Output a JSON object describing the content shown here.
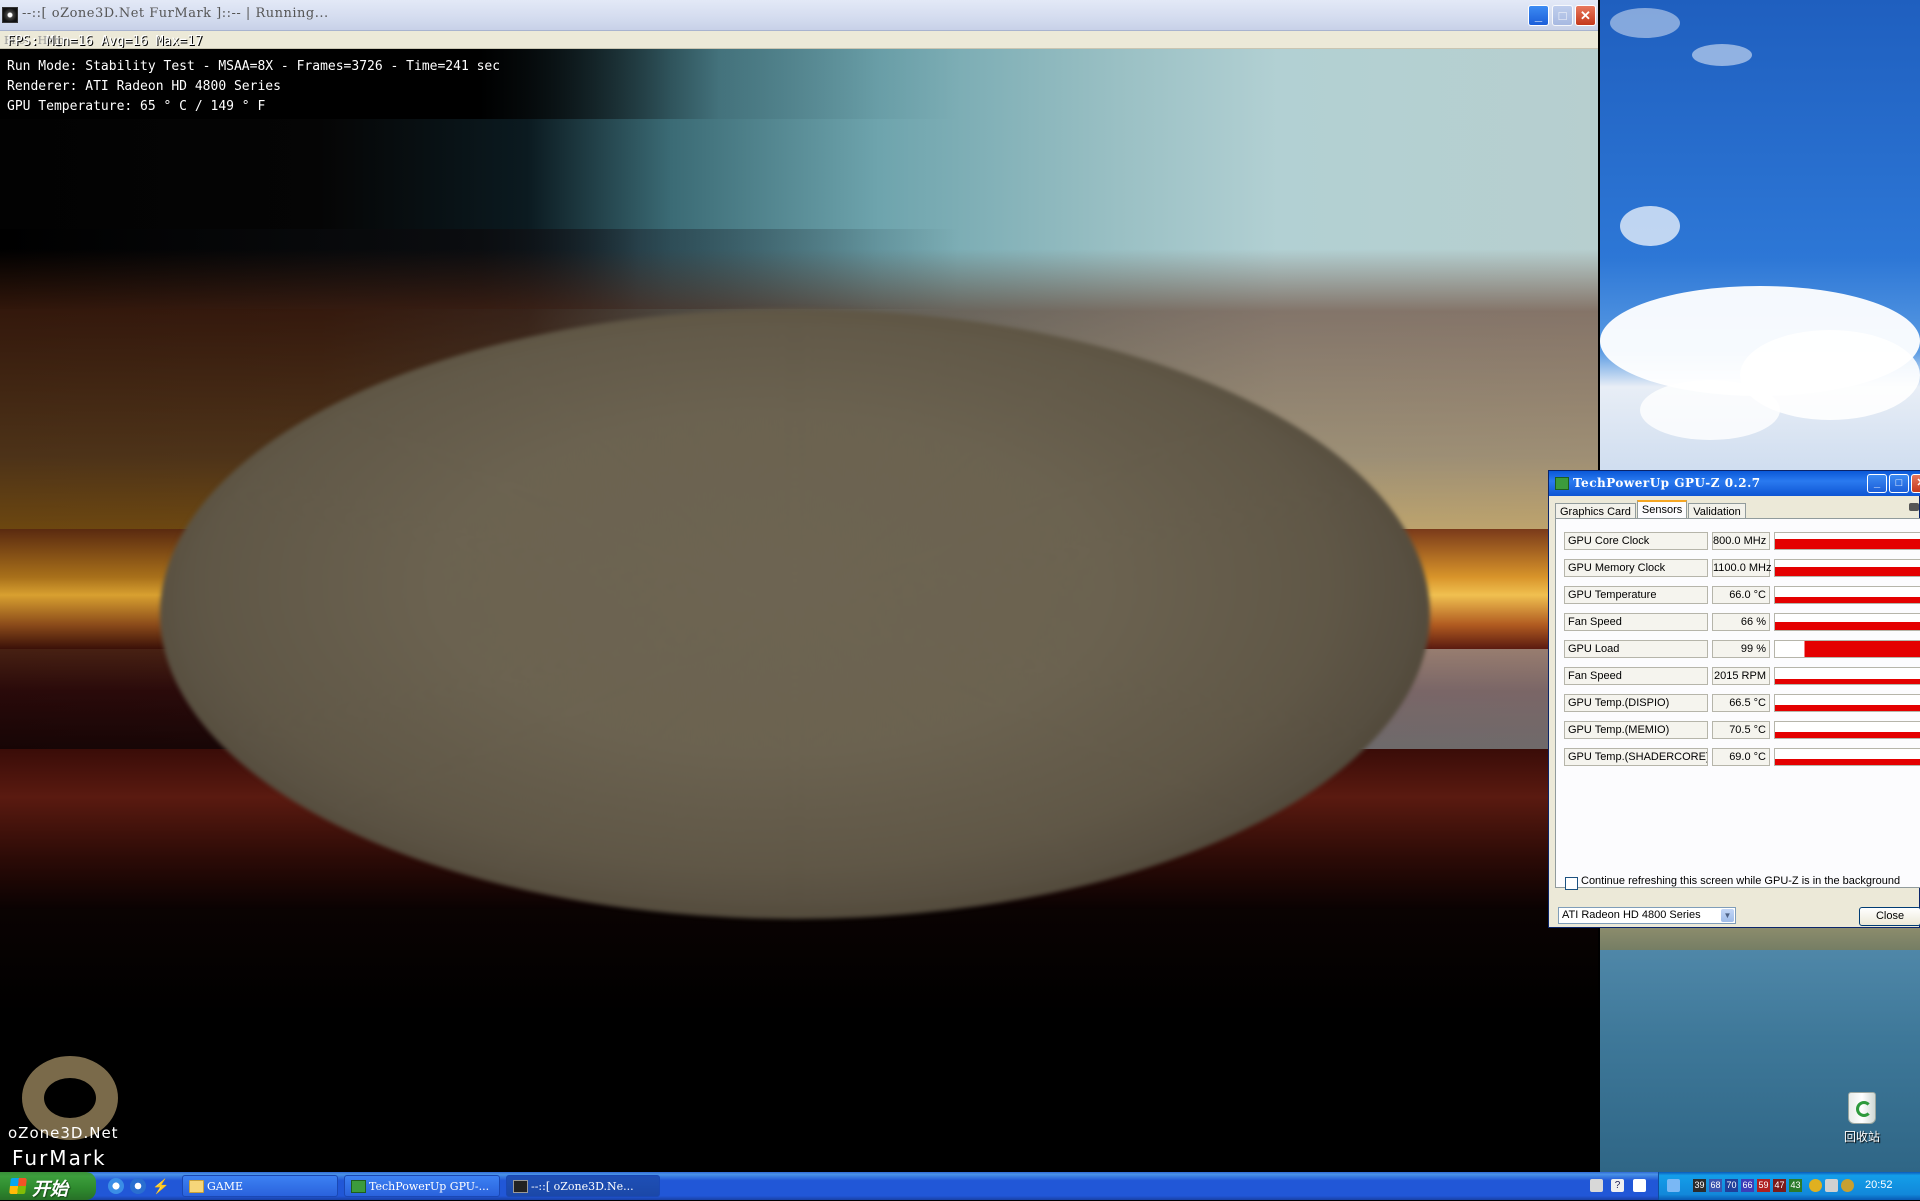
{
  "furmark": {
    "title": "--::[ oZone3D.Net FurMark ]::-- | Running...",
    "menu": [
      "File",
      "Help"
    ],
    "osd": {
      "fps_line": "FPS: Min=16 Avg=16 Max=17",
      "run_mode": "Run Mode: Stability Test - MSAA=8X - Frames=3726 - Time=241 sec",
      "renderer": "Renderer: ATI Radeon HD 4800 Series",
      "temperature": "GPU Temperature: 65 ° C / 149 ° F"
    },
    "logo": {
      "line1": "oZone3D.Net",
      "line2": "FurMark"
    }
  },
  "gpuz": {
    "title": "TechPowerUp GPU-Z 0.2.7",
    "tabs": [
      "Graphics Card",
      "Sensors",
      "Validation"
    ],
    "active_tab": "Sensors",
    "sensors": [
      {
        "label": "GPU Core Clock",
        "value": "800.0 MHz",
        "level": 0.6
      },
      {
        "label": "GPU Memory Clock",
        "value": "1100.0 MHz",
        "level": 0.55
      },
      {
        "label": "GPU Temperature",
        "value": "66.0 °C",
        "level": 0.35
      },
      {
        "label": "Fan Speed",
        "value": "66 %",
        "level": 0.5
      },
      {
        "label": "GPU Load",
        "value": "99 %",
        "level": 0.99
      },
      {
        "label": "Fan Speed",
        "value": "2015 RPM",
        "level": 0.3
      },
      {
        "label": "GPU Temp.(DISPIO)",
        "value": "66.5 °C",
        "level": 0.35
      },
      {
        "label": "GPU Temp.(MEMIO)",
        "value": "70.5 °C",
        "level": 0.4
      },
      {
        "label": "GPU Temp.(SHADERCORE)",
        "value": "69.0 °C",
        "level": 0.38
      }
    ],
    "refresh_checkbox_label": "Continue refreshing this screen while GPU-Z is in the background",
    "refresh_checked": false,
    "device_select": "ATI Radeon HD 4800 Series",
    "close_label": "Close",
    "bar_color": "#e40000"
  },
  "desktop": {
    "recycle_bin_label": "回收站"
  },
  "taskbar": {
    "start_label": "开始",
    "buttons": [
      "GAME",
      "TechPowerUp GPU-...",
      "--::[ oZone3D.Ne..."
    ],
    "tray_numbers": [
      "39",
      "68",
      "70",
      "66",
      "59",
      "47",
      "43"
    ],
    "clock": "20:52"
  }
}
